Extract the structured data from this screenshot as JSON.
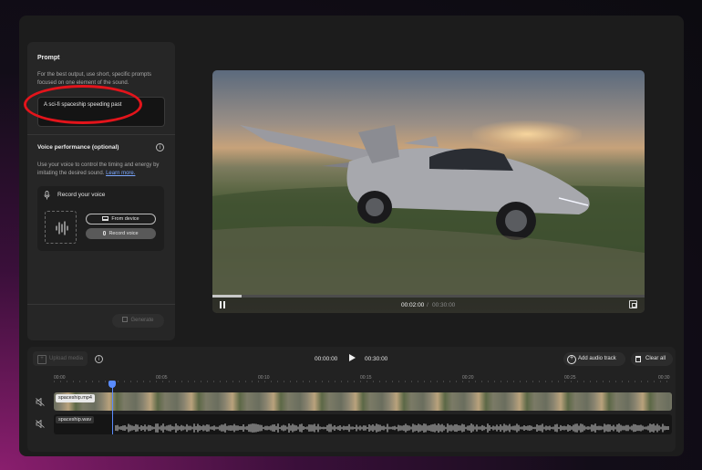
{
  "prompt": {
    "title": "Prompt",
    "description": "For the best output, use short, specific prompts focused on one element of the sound.",
    "value": "A sci-fi spaceship speeding past"
  },
  "voice": {
    "title": "Voice performance (optional)",
    "description": "Use your voice to control the timing and energy by imitating the desired sound.",
    "learn_more": "Learn more.",
    "record_label": "Record your voice",
    "from_device": "From device",
    "record_voice": "Record voice"
  },
  "generate_label": "Generate",
  "player": {
    "current_time": "00:02:00",
    "separator": "/",
    "total_time": "00:30:00",
    "progress": 0.067
  },
  "timeline": {
    "upload_label": "Upload media",
    "time_start": "00:00:00",
    "time_end": "00:30:00",
    "add_audio_label": "Add audio track",
    "clear_all_label": "Clear all",
    "ruler": [
      "00:00",
      "00:05",
      "00:10",
      "00:15",
      "00:20",
      "00:25",
      "00:30"
    ],
    "video_track": "spaceship.mp4",
    "audio_track": "spaceship.wav"
  },
  "colors": {
    "highlight": "#e3141b",
    "accent": "#5a8cff",
    "link": "#7aa7ff"
  }
}
